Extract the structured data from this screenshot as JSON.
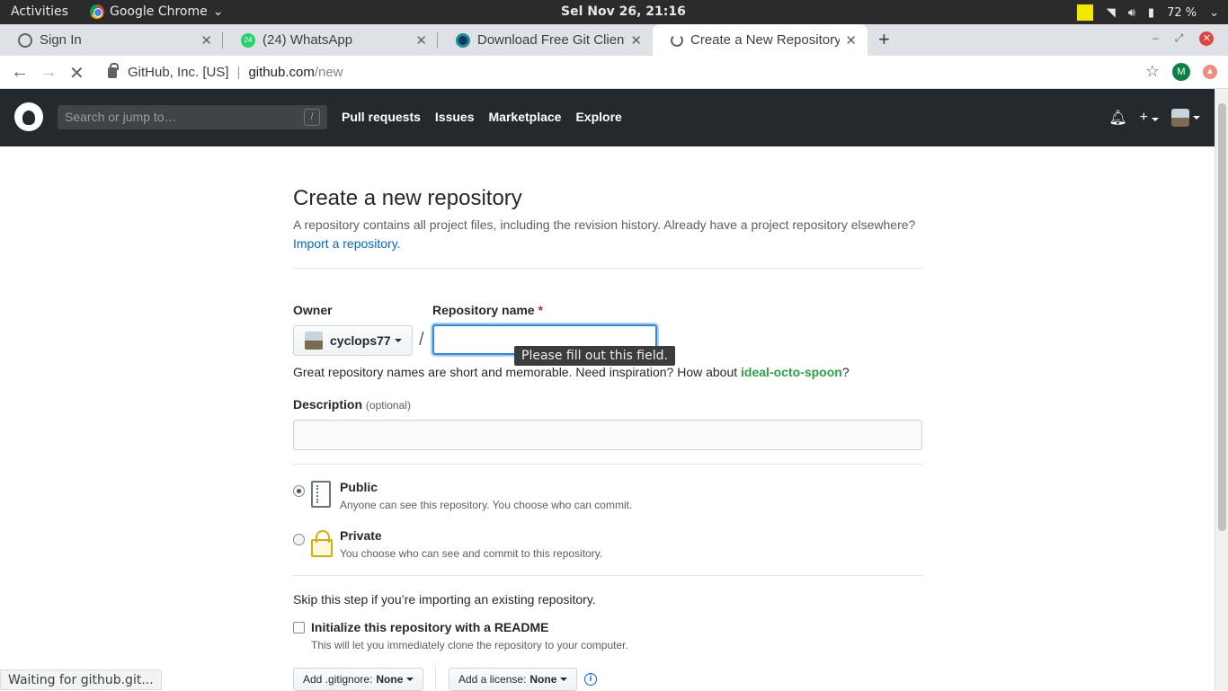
{
  "os": {
    "activities": "Activities",
    "app": "Google Chrome",
    "clock": "Sel Nov 26, 21:16",
    "battery": "72 %"
  },
  "tabs": [
    {
      "title": "Sign In",
      "favicon": "globe-icon"
    },
    {
      "title": "(24) WhatsApp",
      "favicon": "whatsapp-icon",
      "badge": "24"
    },
    {
      "title": "Download Free Git Client",
      "favicon": "git-client-icon"
    },
    {
      "title": "Create a New Repository",
      "favicon": "loading-icon"
    }
  ],
  "address": {
    "org": "GitHub, Inc. [US]",
    "host": "github.com",
    "path": "/new",
    "profile_initial": "M"
  },
  "gh": {
    "search_placeholder": "Search or jump to…",
    "slash_key": "/",
    "nav": [
      "Pull requests",
      "Issues",
      "Marketplace",
      "Explore"
    ]
  },
  "form": {
    "title": "Create a new repository",
    "subhead": "A repository contains all project files, including the revision history. Already have a project repository elsewhere?",
    "import_link": "Import a repository.",
    "owner_label": "Owner",
    "owner_value": "cyclops77",
    "repo_label": "Repository name",
    "required_mark": "*",
    "repo_value": "",
    "tooltip": "Please fill out this field.",
    "hint_prefix": "Great repository names are short and memorable. Need inspiration? How about",
    "hint_suggestion": "ideal-octo-spoon",
    "hint_suffix": "?",
    "desc_label": "Description",
    "desc_optional": "(optional)",
    "desc_value": "",
    "public_title": "Public",
    "public_note": "Anyone can see this repository. You choose who can commit.",
    "private_title": "Private",
    "private_note": "You choose who can see and commit to this repository.",
    "skip_text": "Skip this step if you’re importing an existing repository.",
    "readme_title": "Initialize this repository with a README",
    "readme_note": "This will let you immediately clone the repository to your computer.",
    "gitignore_label": "Add .gitignore:",
    "gitignore_value": "None",
    "license_label": "Add a license:",
    "license_value": "None",
    "info_glyph": "i"
  },
  "status": "Waiting for github.git..."
}
